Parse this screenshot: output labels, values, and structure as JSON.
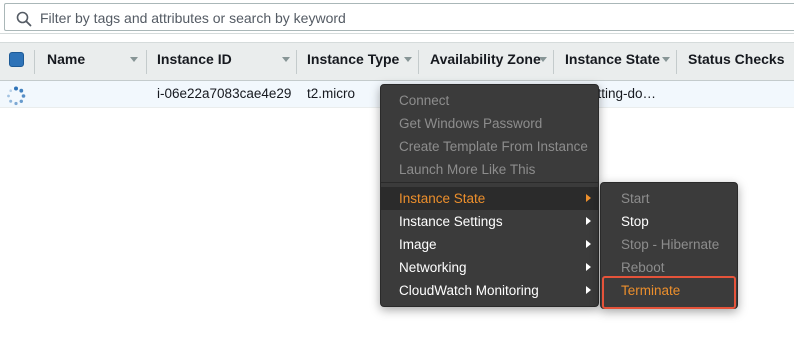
{
  "filter": {
    "placeholder": "Filter by tags and attributes or search by keyword"
  },
  "table": {
    "columns": [
      "Name",
      "Instance ID",
      "Instance Type",
      "Availability Zone",
      "Instance State",
      "Status Checks"
    ],
    "rows": [
      {
        "name": "",
        "instance_id": "i-06e22a7083cae4e29",
        "instance_type": "t2.micro",
        "availability_zone": "",
        "instance_state": "utting-do…",
        "status_checks": ""
      }
    ]
  },
  "context_menu": {
    "items": [
      {
        "label": "Connect",
        "enabled": false
      },
      {
        "label": "Get Windows Password",
        "enabled": false
      },
      {
        "label": "Create Template From Instance",
        "enabled": false
      },
      {
        "label": "Launch More Like This",
        "enabled": false
      },
      {
        "label": "Instance State",
        "enabled": true,
        "submenu": true,
        "active": true
      },
      {
        "label": "Instance Settings",
        "enabled": true,
        "submenu": true
      },
      {
        "label": "Image",
        "enabled": true,
        "submenu": true
      },
      {
        "label": "Networking",
        "enabled": true,
        "submenu": true
      },
      {
        "label": "CloudWatch Monitoring",
        "enabled": true,
        "submenu": true
      }
    ]
  },
  "instance_state_submenu": {
    "items": [
      {
        "label": "Start",
        "enabled": false
      },
      {
        "label": "Stop",
        "enabled": true
      },
      {
        "label": "Stop - Hibernate",
        "enabled": false
      },
      {
        "label": "Reboot",
        "enabled": false
      },
      {
        "label": "Terminate",
        "enabled": true,
        "highlighted": true
      }
    ]
  },
  "colors": {
    "accent_orange": "#ec8f2c",
    "highlight_red": "#e5533a",
    "checkbox_blue": "#2e73b8",
    "menu_bg": "#3b3b3b"
  }
}
